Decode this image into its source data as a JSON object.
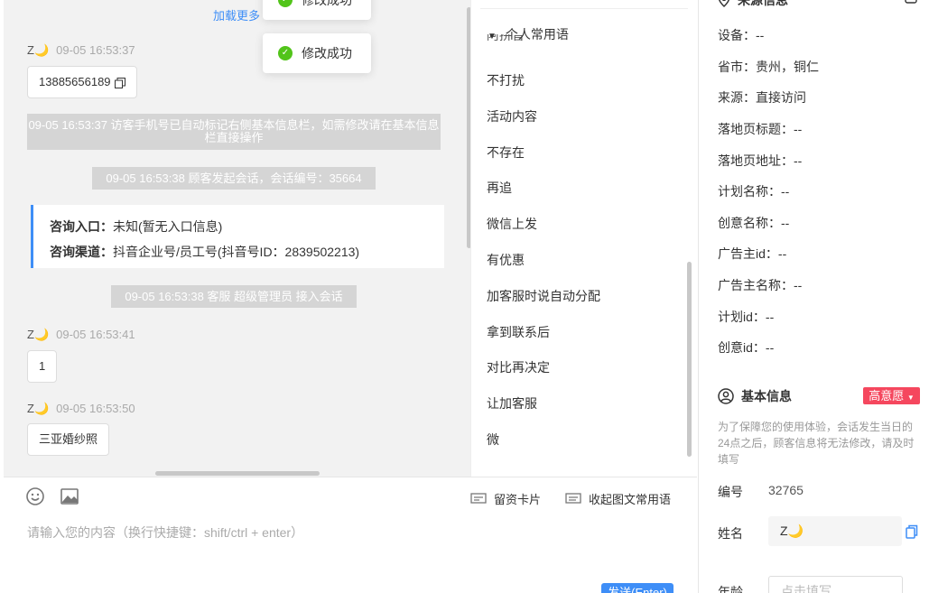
{
  "chat": {
    "load_more": "加载更多",
    "messages": [
      {
        "name": "Z🌙",
        "time": "09-05 16:53:37",
        "text": "13885656189"
      },
      {
        "name": "Z🌙",
        "time": "09-05 16:53:41",
        "text": "1"
      },
      {
        "name": "Z🌙",
        "time": "09-05 16:53:50",
        "text": "三亚婚纱照"
      }
    ],
    "system": {
      "auto_mark": "09-05 16:53:37 访客手机号已自动标记右侧基本信息栏，如需修改请在基本信息栏直接操作",
      "session_start": "09-05 16:53:38 顾客发起会话，会话编号：35664",
      "agent_join": "09-05 16:53:38 客服 超级管理员 接入会话"
    },
    "info_card": {
      "entry_label": "咨询入口：",
      "entry_value": "未知(暂无入口信息)",
      "channel_label": "咨询渠道：",
      "channel_value": "抖音企业号/员工号(抖音号ID：2839502213)"
    },
    "toasts": [
      "修改成功",
      "修改成功"
    ]
  },
  "phrases": {
    "header": "个人常用语",
    "partial_top": "阿拼音",
    "items": [
      "不打扰",
      "活动内容",
      "不存在",
      "再追",
      "微信上发",
      "有优惠",
      "加客服时说自动分配",
      "拿到联系后",
      "对比再决定",
      "让加客服",
      "微"
    ]
  },
  "input": {
    "placeholder": "请输入您的内容（换行快捷键：shift/ctrl + enter）",
    "lead_card": "留资卡片",
    "collapse_phrases": "收起图文常用语",
    "send": "发送(Enter)"
  },
  "right": {
    "source_title": "来源信息",
    "source_fields": [
      {
        "label": "设备：",
        "value": "--"
      },
      {
        "label": "省市：",
        "value": "贵州，铜仁"
      },
      {
        "label": "来源：",
        "value": "直接访问"
      },
      {
        "label": "落地页标题：",
        "value": "--"
      },
      {
        "label": "落地页地址：",
        "value": "--"
      },
      {
        "label": "计划名称：",
        "value": "--"
      },
      {
        "label": "创意名称：",
        "value": "--"
      },
      {
        "label": "广告主id：",
        "value": "--"
      },
      {
        "label": "广告主名称：",
        "value": "--"
      },
      {
        "label": "计划id：",
        "value": "--"
      },
      {
        "label": "创意id：",
        "value": "--"
      }
    ],
    "basic_title": "基本信息",
    "intent_badge": "高意愿",
    "note": "为了保障您的使用体验，会话发生当日的24点之后，顾客信息将无法修改，请及时填写",
    "id_label": "编号",
    "id_value": "32765",
    "name_label": "姓名",
    "name_value": "Z🌙",
    "age_label": "年龄",
    "age_placeholder": "点击填写"
  },
  "colors": {
    "accent": "#3e8ef7",
    "success": "#52c41a",
    "intent": "#f5475e"
  }
}
